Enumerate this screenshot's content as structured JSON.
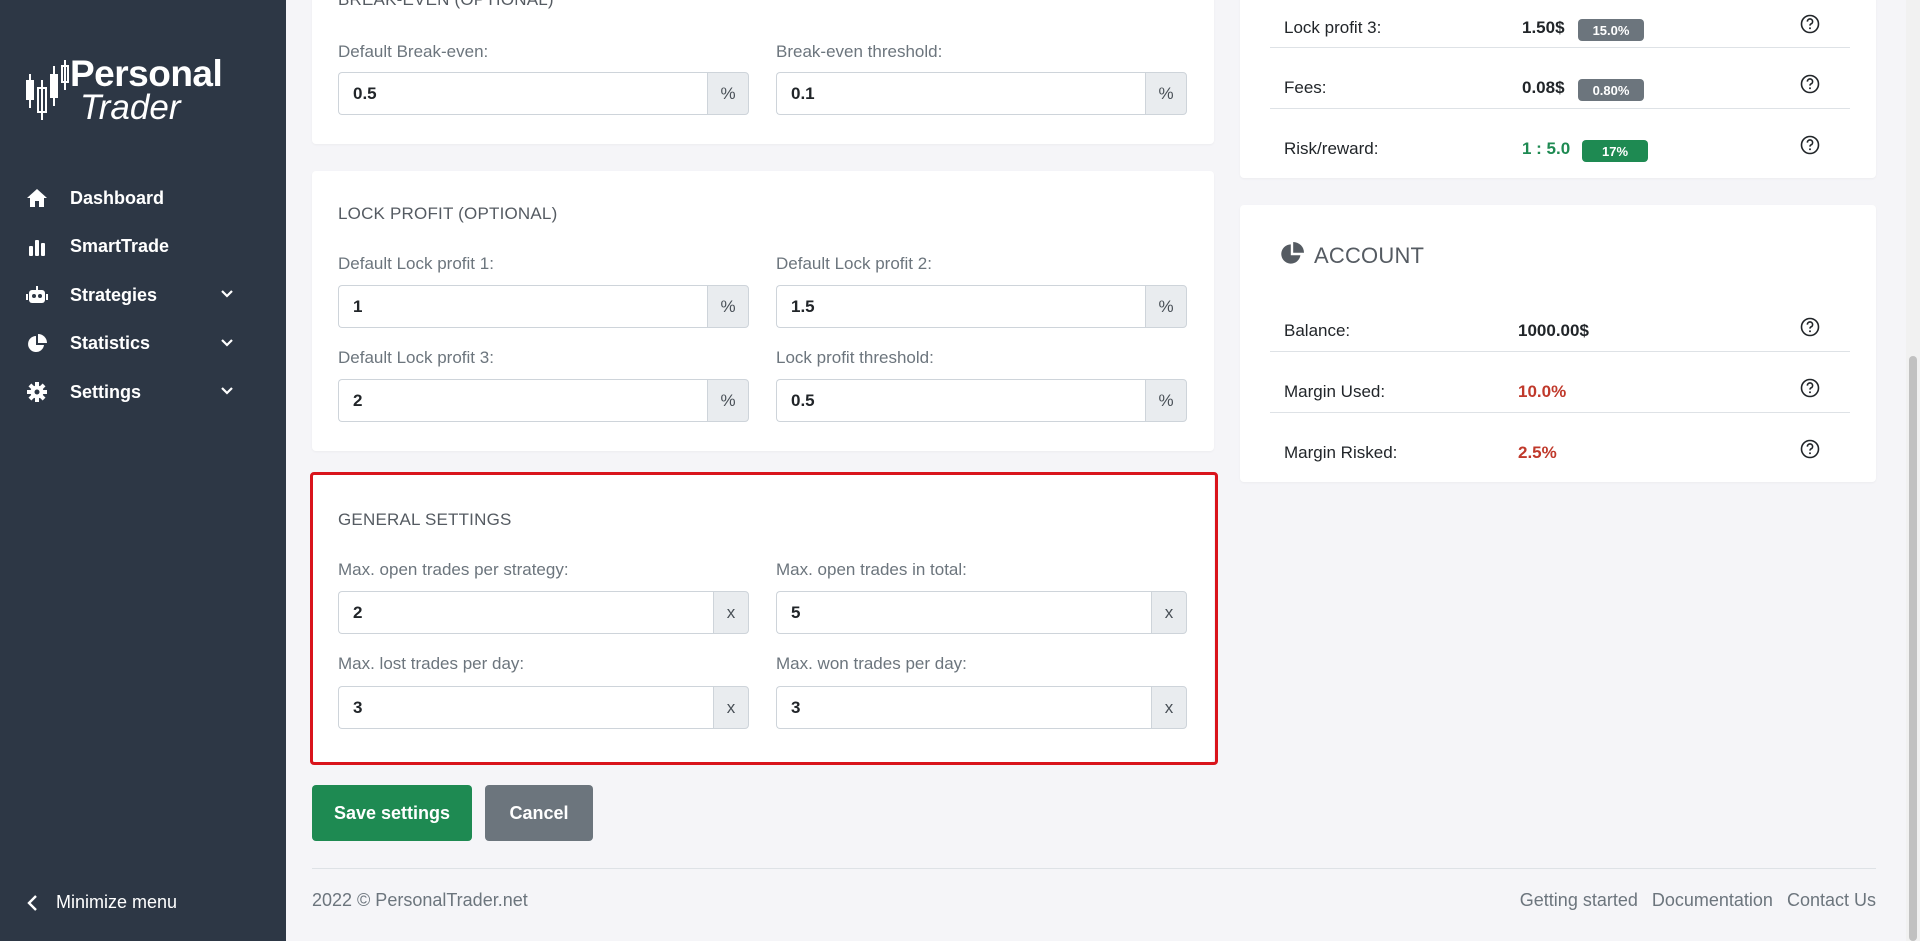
{
  "logo": {
    "line1": "Personal",
    "line2": "Trader"
  },
  "nav": {
    "items": [
      {
        "label": "Dashboard",
        "icon": "home-icon"
      },
      {
        "label": "SmartTrade",
        "icon": "bar-chart-icon"
      },
      {
        "label": "Strategies",
        "icon": "robot-icon",
        "expandable": true
      },
      {
        "label": "Statistics",
        "icon": "pie-chart-icon",
        "expandable": true
      },
      {
        "label": "Settings",
        "icon": "gear-icon",
        "expandable": true
      }
    ],
    "minimize_label": "Minimize menu"
  },
  "break_even": {
    "title": "BREAK-EVEN (OPTIONAL)",
    "default_label": "Default Break-even:",
    "default_value": "0.5",
    "default_unit": "%",
    "threshold_label": "Break-even threshold:",
    "threshold_value": "0.1",
    "threshold_unit": "%"
  },
  "lock_profit": {
    "title": "LOCK PROFIT (OPTIONAL)",
    "lp1_label": "Default Lock profit 1:",
    "lp1_value": "1",
    "lp2_label": "Default Lock profit 2:",
    "lp2_value": "1.5",
    "lp3_label": "Default Lock profit 3:",
    "lp3_value": "2",
    "threshold_label": "Lock profit threshold:",
    "threshold_value": "0.5",
    "unit": "%"
  },
  "general": {
    "title": "GENERAL SETTINGS",
    "per_strategy_label": "Max. open trades per strategy:",
    "per_strategy_value": "2",
    "total_label": "Max. open trades in total:",
    "total_value": "5",
    "lost_label": "Max. lost trades per day:",
    "lost_value": "3",
    "won_label": "Max. won trades per day:",
    "won_value": "3",
    "unit": "x"
  },
  "buttons": {
    "save": "Save settings",
    "cancel": "Cancel"
  },
  "summary": {
    "rows": [
      {
        "label": "Lock profit 3:",
        "value": "1.50$",
        "badge": "15.0%"
      },
      {
        "label": "Fees:",
        "value": "0.08$",
        "badge": "0.80%"
      },
      {
        "label": "Risk/reward:",
        "value": "1 : 5.0",
        "badge": "17%"
      }
    ]
  },
  "account": {
    "title": "ACCOUNT",
    "rows": [
      {
        "label": "Balance:",
        "value": "1000.00$"
      },
      {
        "label": "Margin Used:",
        "value": "10.0%"
      },
      {
        "label": "Margin Risked:",
        "value": "2.5%"
      }
    ]
  },
  "footer": {
    "copyright": "2022 © PersonalTrader.net",
    "links": [
      "Getting started",
      "Documentation",
      "Contact Us"
    ]
  },
  "colors": {
    "sidebar_bg": "#2d3745",
    "success": "#1e8a52",
    "danger": "#c0392b",
    "secondary": "#6c757d",
    "highlight_border": "#d9141c"
  }
}
